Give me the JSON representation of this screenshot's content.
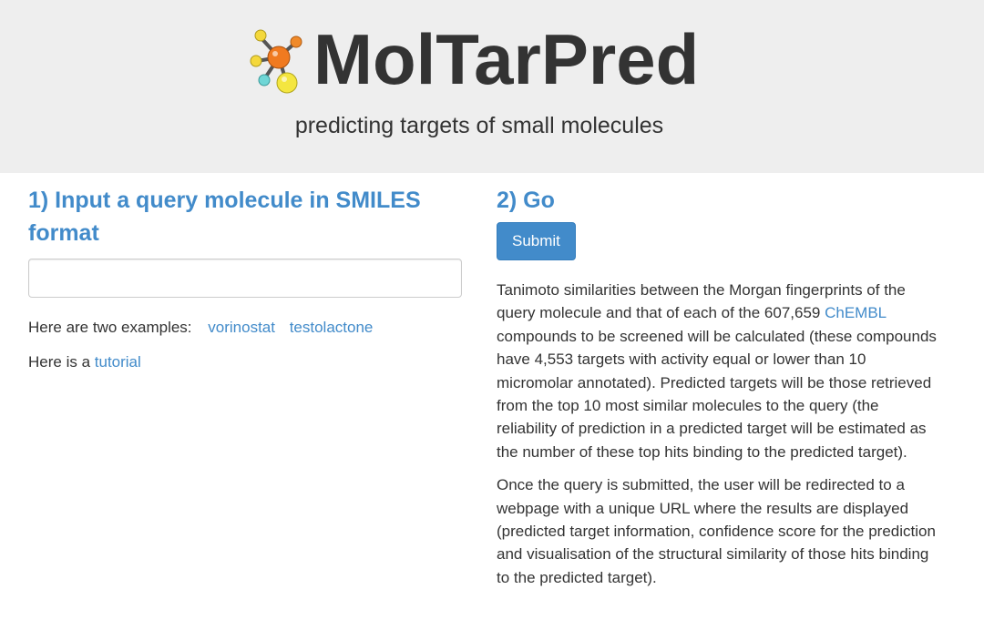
{
  "header": {
    "logo_text": "MolTarPred",
    "subtitle": "predicting targets of small molecules"
  },
  "input_section": {
    "heading": "1) Input a query molecule in SMILES format",
    "smiles_value": "",
    "smiles_placeholder": "",
    "examples_label": "Here are two examples:",
    "example_1": "vorinostat",
    "example_2": "testolactone",
    "tutorial_prefix": "Here is a",
    "tutorial_link": "tutorial"
  },
  "go_section": {
    "heading": "2) Go",
    "submit_label": "Submit",
    "para1_a": "Tanimoto similarities between the Morgan fingerprints of the query molecule and that of each of the 607,659",
    "chembl_link": "ChEMBL",
    "para1_b": "compounds to be screened will be calculated (these compounds have 4,553 targets with activity equal or lower than 10 micromolar annotated). Predicted targets will be those retrieved from the top 10 most similar molecules to the query (the reliability of prediction in a predicted target will be estimated as the number of these top hits binding to the predicted target).",
    "para2": "Once the query is submitted, the user will be redirected to a webpage with a unique URL where the results are displayed (predicted target information, confidence score for the prediction and visualisation of the structural similarity of those hits binding to the predicted target)."
  },
  "colors": {
    "header_bg": "#eeeeee",
    "accent": "#428bca",
    "text": "#333333"
  },
  "icons": {
    "logo": "molecule-icon"
  }
}
